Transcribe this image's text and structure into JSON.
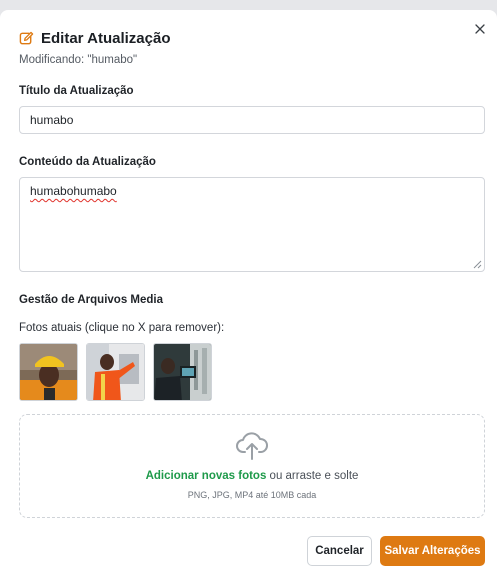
{
  "colors": {
    "accent": "#de7a12",
    "link": "#1e9a4a",
    "border": "#d3d6db"
  },
  "header": {
    "icon": "edit-icon",
    "title": "Editar Atualização",
    "subtitle": "Modificando: \"humabo\""
  },
  "close_icon": "close-icon",
  "form": {
    "title_label": "Título da Atualização",
    "title_value": "humabo",
    "content_label": "Conteúdo da Atualização",
    "content_value": "humabohumabo"
  },
  "media": {
    "section_label": "Gestão de Arquivos Media",
    "current_photos_label": "Fotos atuais (clique no X para remover):",
    "photos": [
      {
        "name": "photo-1"
      },
      {
        "name": "photo-2"
      },
      {
        "name": "photo-3"
      }
    ],
    "upload_icon": "cloud-upload-icon",
    "add_link": "Adicionar novas fotos",
    "add_rest": " ou arraste e solte",
    "hint": "PNG, JPG, MP4 até 10MB cada"
  },
  "buttons": {
    "cancel": "Cancelar",
    "save": "Salvar Alterações"
  }
}
